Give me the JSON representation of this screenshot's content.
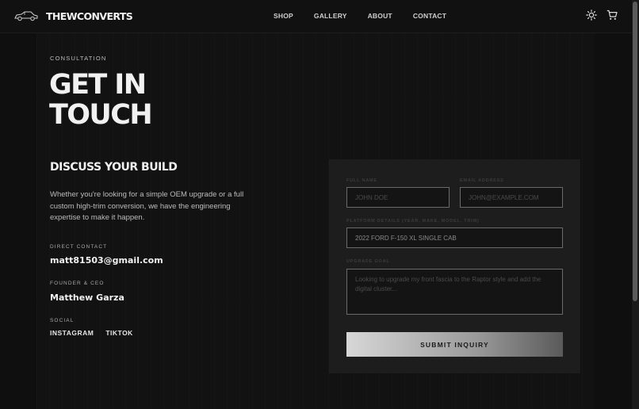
{
  "brand": {
    "name": "THEWCONVERTS",
    "logo_icon": "car-icon"
  },
  "nav": {
    "items": [
      "SHOP",
      "GALLERY",
      "ABOUT",
      "CONTACT"
    ]
  },
  "header_icons": {
    "theme": "sun-icon",
    "cart": "cart-icon"
  },
  "hero": {
    "eyebrow": "CONSULTATION",
    "title_line1": "GET IN",
    "title_line2": "TOUCH"
  },
  "info": {
    "heading": "DISCUSS YOUR BUILD",
    "description": "Whether you're looking for a simple OEM upgrade or a full custom high-trim conversion, we have the engineering expertise to make it happen.",
    "direct_contact_label": "DIRECT CONTACT",
    "email": "matt81503@gmail.com",
    "founder_label": "FOUNDER & CEO",
    "founder_name": "Matthew Garza",
    "social_label": "SOCIAL",
    "social_links": [
      "INSTAGRAM",
      "TIKTOK"
    ]
  },
  "form": {
    "full_name_label": "FULL NAME",
    "full_name_placeholder": "JOHN DOE",
    "email_label": "EMAIL ADDRESS",
    "email_placeholder": "JOHN@EXAMPLE.COM",
    "platform_label": "PLATFORM DETAILS (YEAR, MAKE, MODEL, TRIM)",
    "platform_value": "2022 FORD F-150 XL SINGLE CAB",
    "goal_label": "UPGRADE GOAL",
    "goal_placeholder": "Looking to upgrade my front fascia to the Raptor style and add the digital cluster...",
    "submit_label": "SUBMIT INQUIRY"
  },
  "colors": {
    "background": "#0f0f0f",
    "card": "#1d1d1d",
    "text": "#f1f1f1",
    "muted": "#bcbcbc"
  }
}
